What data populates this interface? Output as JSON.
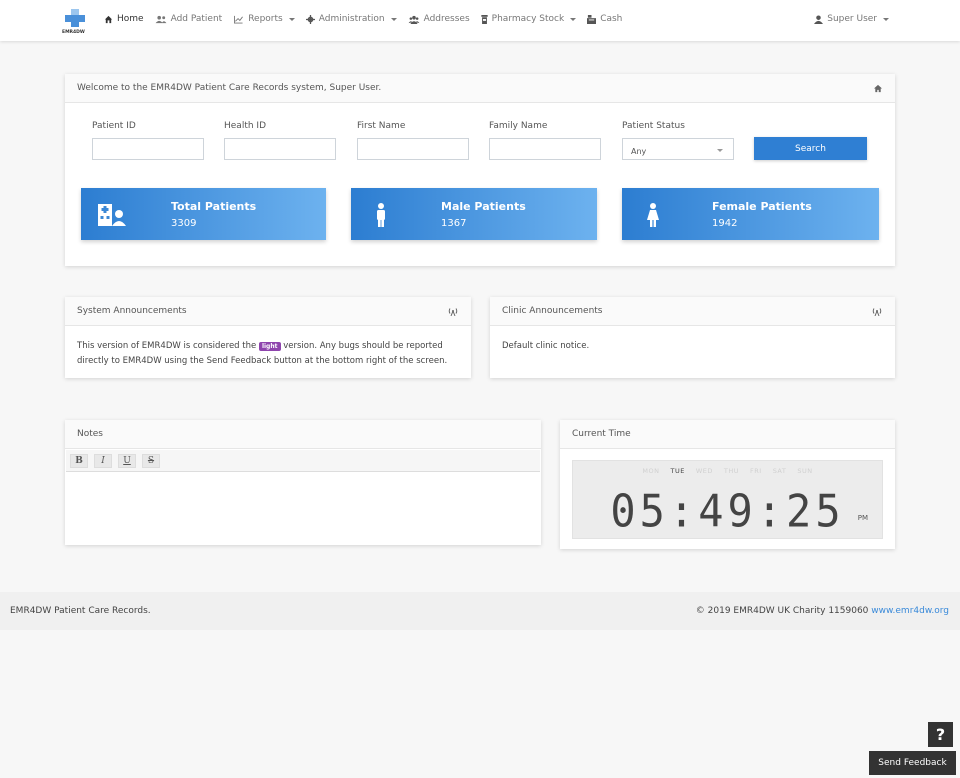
{
  "nav": {
    "logo_text": "EMR4DW",
    "items": [
      {
        "label": "Home",
        "icon": "home-icon",
        "dropdown": false,
        "active": true
      },
      {
        "label": "Add Patient",
        "icon": "users-icon",
        "dropdown": false
      },
      {
        "label": "Reports",
        "icon": "chart-icon",
        "dropdown": true
      },
      {
        "label": "Administration",
        "icon": "gear-icon",
        "dropdown": true
      },
      {
        "label": "Addresses",
        "icon": "people-group-icon",
        "dropdown": false
      },
      {
        "label": "Pharmacy Stock",
        "icon": "pill-bottle-icon",
        "dropdown": true
      },
      {
        "label": "Cash",
        "icon": "cash-register-icon",
        "dropdown": false
      }
    ],
    "user": "Super User"
  },
  "welcome": {
    "text": "Welcome to the EMR4DW Patient Care Records system, Super User.",
    "fields": {
      "patient_id": "Patient ID",
      "health_id": "Health ID",
      "first_name": "First Name",
      "family_name": "Family Name",
      "patient_status": "Patient Status"
    },
    "status_value": "Any",
    "search_label": "Search"
  },
  "stats": [
    {
      "title": "Total Patients",
      "value": "3309",
      "icon": "hospital-user-icon"
    },
    {
      "title": "Male Patients",
      "value": "1367",
      "icon": "male-icon"
    },
    {
      "title": "Female Patients",
      "value": "1942",
      "icon": "female-icon"
    }
  ],
  "system_announcements": {
    "title": "System Announcements",
    "text_before": "This version of EMR4DW is considered the",
    "badge": "light",
    "text_after": "version. Any bugs should be reported directly to EMR4DW using the Send Feedback button at the bottom right of the screen."
  },
  "clinic_announcements": {
    "title": "Clinic Announcements",
    "text": "Default clinic notice."
  },
  "notes": {
    "title": "Notes",
    "toolbar": [
      "B",
      "I",
      "U",
      "S"
    ]
  },
  "clock": {
    "title": "Current Time",
    "days": [
      "MON",
      "TUE",
      "WED",
      "THU",
      "FRI",
      "SAT",
      "SUN"
    ],
    "active_day": "TUE",
    "time": "05:49:25",
    "ampm": "PM"
  },
  "footer": {
    "left": "EMR4DW Patient Care Records.",
    "right": "© 2019 EMR4DW  UK Charity 1159060",
    "link": "www.emr4dw.org"
  },
  "help_label": "?",
  "feedback_label": "Send Feedback",
  "colors": {
    "accent": "#2f7fd3",
    "badge": "#8e44ad",
    "link": "#3a8ad9"
  }
}
